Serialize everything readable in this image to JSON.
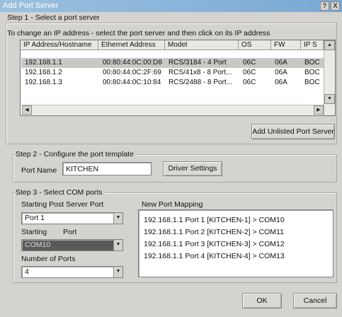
{
  "window": {
    "title": "Add Port Server",
    "help_button": "?",
    "close_button": "X"
  },
  "step1": {
    "title": "Step 1 - Select a port server",
    "instruction": "To change an IP address - select the port server and then click on its IP address",
    "columns": [
      "IP Address/Hostname",
      "Ethernet Address",
      "Model",
      "OS",
      "FW",
      "IP S"
    ],
    "rows": [
      [
        "192.168.1.1",
        "00:80:44:0C:00:D8",
        "RCS/3184 - 4 Port",
        "06C",
        "06A",
        "BOC"
      ],
      [
        "192.168.1.2",
        "00:80:44:0C:2F:69",
        "RCS/41x8 - 8 Port...",
        "06C",
        "06A",
        "BOC"
      ],
      [
        "192.168.1.3",
        "00:80:44:0C:10:84",
        "RCS/2488 - 8 Port...",
        "06C",
        "06A",
        "BOC"
      ]
    ],
    "add_unlisted_button": "Add Unlisted Port Server"
  },
  "step2": {
    "title": "Step 2 - Configure the port template",
    "port_name_label": "Port Name",
    "port_name_value": "KITCHEN",
    "driver_settings_button": "Driver Settings"
  },
  "step3": {
    "title": "Step 3 - Select COM ports",
    "starting_server_port_label": "Starting Post Server Port",
    "starting_server_port_value": "Port 1",
    "starting_label": "Starting",
    "port_label": "Port",
    "starting_com_value": "COM10",
    "number_of_ports_label": "Number of Ports",
    "number_of_ports_value": "4",
    "new_mapping_label": "New Port Mapping",
    "mappings": [
      "192.168.1.1   Port 1 [KITCHEN-1] > COM10",
      "192.168.1.1   Port 2 [KITCHEN-2] > COM11",
      "192.168.1.1   Port 3 [KITCHEN-3] > COM12",
      "192.168.1.1   Port 4 [KITCHEN-4] > COM13"
    ]
  },
  "footer": {
    "ok_button": "OK",
    "cancel_button": "Cancel"
  }
}
